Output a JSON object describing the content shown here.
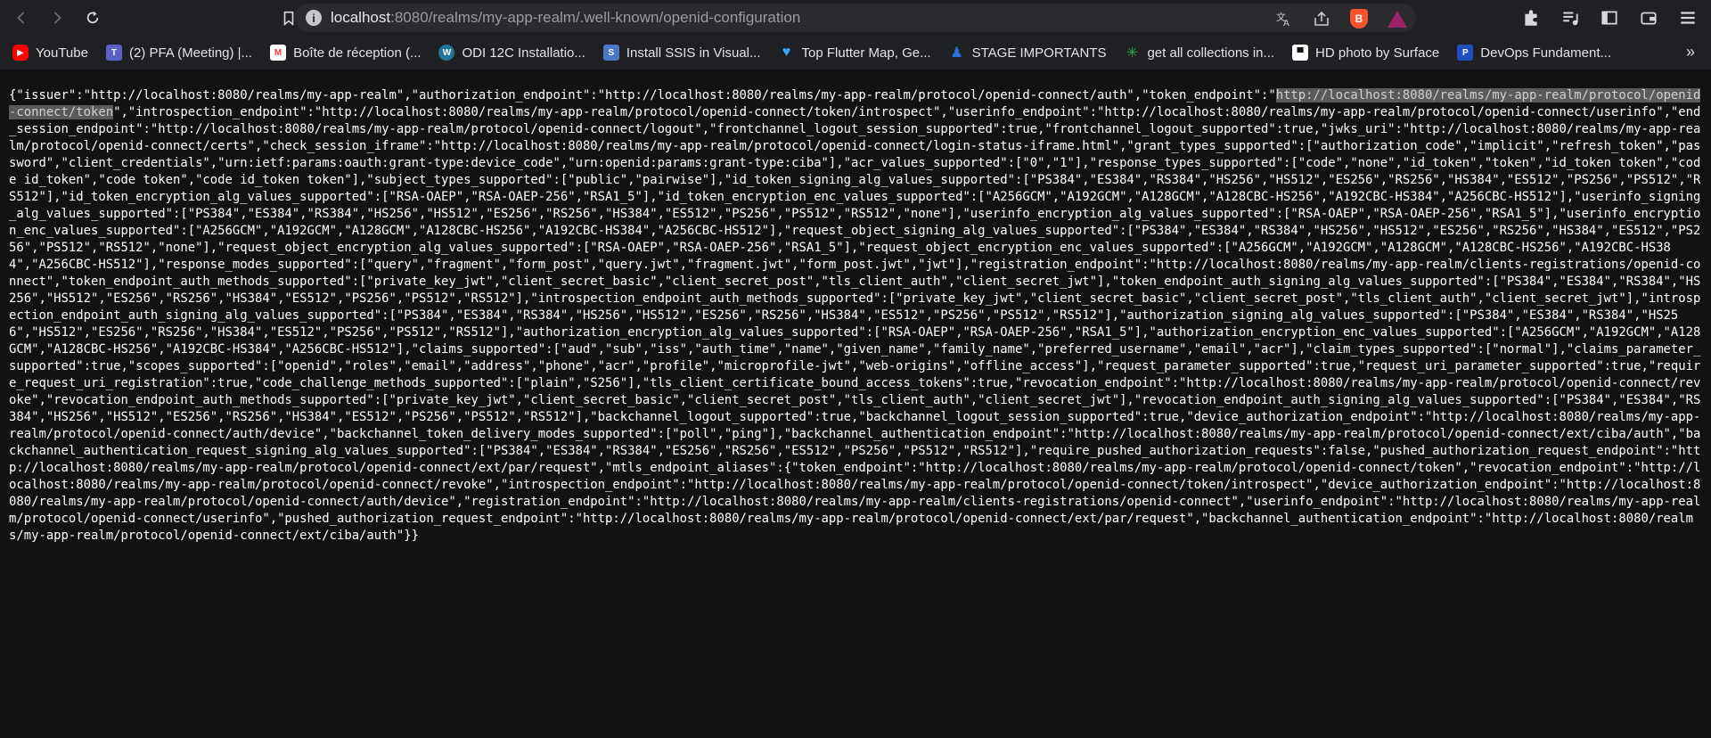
{
  "browser": {
    "url": {
      "host": "localhost",
      "rest": ":8080/realms/my-app-realm/.well-known/openid-configuration"
    }
  },
  "bookmarks": [
    {
      "label": "YouTube",
      "icon": "youtube-icon",
      "color": "#ff0000"
    },
    {
      "label": "(2) PFA (Meeting) |...",
      "icon": "teams-icon",
      "color": "#5b5fc7"
    },
    {
      "label": "Boîte de réception (...",
      "icon": "gmail-icon",
      "color": "#ea4335"
    },
    {
      "label": "ODI 12C Installatio...",
      "icon": "wordpress-icon",
      "color": "#21759b"
    },
    {
      "label": "Install SSIS in Visual...",
      "icon": "ssis-icon",
      "color": "#4a78c2"
    },
    {
      "label": "Top Flutter Map, Ge...",
      "icon": "heart-icon",
      "color": "#35a7ff"
    },
    {
      "label": "STAGE IMPORTANTS",
      "icon": "person-icon",
      "color": "#2f6fdd"
    },
    {
      "label": "get all collections in...",
      "icon": "spark-icon",
      "color": "#2ea44f"
    },
    {
      "label": "HD photo by Surface",
      "icon": "unsplash-icon",
      "color": "#111111"
    },
    {
      "label": "DevOps Fundament...",
      "icon": "p-icon",
      "color": "#1f4fbf"
    }
  ],
  "json_text": {
    "before_selection": "{\"issuer\":\"http://localhost:8080/realms/my-app-realm\",\"authorization_endpoint\":\"http://localhost:8080/realms/my-app-realm/protocol/openid-connect/auth\",\"token_endpoint\":\"",
    "selection": "http://localhost:8080/realms/my-app-realm/protocol/openid-connect/token",
    "after_selection": "\",\"introspection_endpoint\":\"http://localhost:8080/realms/my-app-realm/protocol/openid-connect/token/introspect\",\"userinfo_endpoint\":\"http://localhost:8080/realms/my-app-realm/protocol/openid-connect/userinfo\",\"end_session_endpoint\":\"http://localhost:8080/realms/my-app-realm/protocol/openid-connect/logout\",\"frontchannel_logout_session_supported\":true,\"frontchannel_logout_supported\":true,\"jwks_uri\":\"http://localhost:8080/realms/my-app-realm/protocol/openid-connect/certs\",\"check_session_iframe\":\"http://localhost:8080/realms/my-app-realm/protocol/openid-connect/login-status-iframe.html\",\"grant_types_supported\":[\"authorization_code\",\"implicit\",\"refresh_token\",\"password\",\"client_credentials\",\"urn:ietf:params:oauth:grant-type:device_code\",\"urn:openid:params:grant-type:ciba\"],\"acr_values_supported\":[\"0\",\"1\"],\"response_types_supported\":[\"code\",\"none\",\"id_token\",\"token\",\"id_token token\",\"code id_token\",\"code token\",\"code id_token token\"],\"subject_types_supported\":[\"public\",\"pairwise\"],\"id_token_signing_alg_values_supported\":[\"PS384\",\"ES384\",\"RS384\",\"HS256\",\"HS512\",\"ES256\",\"RS256\",\"HS384\",\"ES512\",\"PS256\",\"PS512\",\"RS512\"],\"id_token_encryption_alg_values_supported\":[\"RSA-OAEP\",\"RSA-OAEP-256\",\"RSA1_5\"],\"id_token_encryption_enc_values_supported\":[\"A256GCM\",\"A192GCM\",\"A128GCM\",\"A128CBC-HS256\",\"A192CBC-HS384\",\"A256CBC-HS512\"],\"userinfo_signing_alg_values_supported\":[\"PS384\",\"ES384\",\"RS384\",\"HS256\",\"HS512\",\"ES256\",\"RS256\",\"HS384\",\"ES512\",\"PS256\",\"PS512\",\"RS512\",\"none\"],\"userinfo_encryption_alg_values_supported\":[\"RSA-OAEP\",\"RSA-OAEP-256\",\"RSA1_5\"],\"userinfo_encryption_enc_values_supported\":[\"A256GCM\",\"A192GCM\",\"A128GCM\",\"A128CBC-HS256\",\"A192CBC-HS384\",\"A256CBC-HS512\"],\"request_object_signing_alg_values_supported\":[\"PS384\",\"ES384\",\"RS384\",\"HS256\",\"HS512\",\"ES256\",\"RS256\",\"HS384\",\"ES512\",\"PS256\",\"PS512\",\"RS512\",\"none\"],\"request_object_encryption_alg_values_supported\":[\"RSA-OAEP\",\"RSA-OAEP-256\",\"RSA1_5\"],\"request_object_encryption_enc_values_supported\":[\"A256GCM\",\"A192GCM\",\"A128GCM\",\"A128CBC-HS256\",\"A192CBC-HS384\",\"A256CBC-HS512\"],\"response_modes_supported\":[\"query\",\"fragment\",\"form_post\",\"query.jwt\",\"fragment.jwt\",\"form_post.jwt\",\"jwt\"],\"registration_endpoint\":\"http://localhost:8080/realms/my-app-realm/clients-registrations/openid-connect\",\"token_endpoint_auth_methods_supported\":[\"private_key_jwt\",\"client_secret_basic\",\"client_secret_post\",\"tls_client_auth\",\"client_secret_jwt\"],\"token_endpoint_auth_signing_alg_values_supported\":[\"PS384\",\"ES384\",\"RS384\",\"HS256\",\"HS512\",\"ES256\",\"RS256\",\"HS384\",\"ES512\",\"PS256\",\"PS512\",\"RS512\"],\"introspection_endpoint_auth_methods_supported\":[\"private_key_jwt\",\"client_secret_basic\",\"client_secret_post\",\"tls_client_auth\",\"client_secret_jwt\"],\"introspection_endpoint_auth_signing_alg_values_supported\":[\"PS384\",\"ES384\",\"RS384\",\"HS256\",\"HS512\",\"ES256\",\"RS256\",\"HS384\",\"ES512\",\"PS256\",\"PS512\",\"RS512\"],\"authorization_signing_alg_values_supported\":[\"PS384\",\"ES384\",\"RS384\",\"HS256\",\"HS512\",\"ES256\",\"RS256\",\"HS384\",\"ES512\",\"PS256\",\"PS512\",\"RS512\"],\"authorization_encryption_alg_values_supported\":[\"RSA-OAEP\",\"RSA-OAEP-256\",\"RSA1_5\"],\"authorization_encryption_enc_values_supported\":[\"A256GCM\",\"A192GCM\",\"A128GCM\",\"A128CBC-HS256\",\"A192CBC-HS384\",\"A256CBC-HS512\"],\"claims_supported\":[\"aud\",\"sub\",\"iss\",\"auth_time\",\"name\",\"given_name\",\"family_name\",\"preferred_username\",\"email\",\"acr\"],\"claim_types_supported\":[\"normal\"],\"claims_parameter_supported\":true,\"scopes_supported\":[\"openid\",\"roles\",\"email\",\"address\",\"phone\",\"acr\",\"profile\",\"microprofile-jwt\",\"web-origins\",\"offline_access\"],\"request_parameter_supported\":true,\"request_uri_parameter_supported\":true,\"require_request_uri_registration\":true,\"code_challenge_methods_supported\":[\"plain\",\"S256\"],\"tls_client_certificate_bound_access_tokens\":true,\"revocation_endpoint\":\"http://localhost:8080/realms/my-app-realm/protocol/openid-connect/revoke\",\"revocation_endpoint_auth_methods_supported\":[\"private_key_jwt\",\"client_secret_basic\",\"client_secret_post\",\"tls_client_auth\",\"client_secret_jwt\"],\"revocation_endpoint_auth_signing_alg_values_supported\":[\"PS384\",\"ES384\",\"RS384\",\"HS256\",\"HS512\",\"ES256\",\"RS256\",\"HS384\",\"ES512\",\"PS256\",\"PS512\",\"RS512\"],\"backchannel_logout_supported\":true,\"backchannel_logout_session_supported\":true,\"device_authorization_endpoint\":\"http://localhost:8080/realms/my-app-realm/protocol/openid-connect/auth/device\",\"backchannel_token_delivery_modes_supported\":[\"poll\",\"ping\"],\"backchannel_authentication_endpoint\":\"http://localhost:8080/realms/my-app-realm/protocol/openid-connect/ext/ciba/auth\",\"backchannel_authentication_request_signing_alg_values_supported\":[\"PS384\",\"ES384\",\"RS384\",\"ES256\",\"RS256\",\"ES512\",\"PS256\",\"PS512\",\"RS512\"],\"require_pushed_authorization_requests\":false,\"pushed_authorization_request_endpoint\":\"http://localhost:8080/realms/my-app-realm/protocol/openid-connect/ext/par/request\",\"mtls_endpoint_aliases\":{\"token_endpoint\":\"http://localhost:8080/realms/my-app-realm/protocol/openid-connect/token\",\"revocation_endpoint\":\"http://localhost:8080/realms/my-app-realm/protocol/openid-connect/revoke\",\"introspection_endpoint\":\"http://localhost:8080/realms/my-app-realm/protocol/openid-connect/token/introspect\",\"device_authorization_endpoint\":\"http://localhost:8080/realms/my-app-realm/protocol/openid-connect/auth/device\",\"registration_endpoint\":\"http://localhost:8080/realms/my-app-realm/clients-registrations/openid-connect\",\"userinfo_endpoint\":\"http://localhost:8080/realms/my-app-realm/protocol/openid-connect/userinfo\",\"pushed_authorization_request_endpoint\":\"http://localhost:8080/realms/my-app-realm/protocol/openid-connect/ext/par/request\",\"backchannel_authentication_endpoint\":\"http://localhost:8080/realms/my-app-realm/protocol/openid-connect/ext/ciba/auth\"}}"
  }
}
